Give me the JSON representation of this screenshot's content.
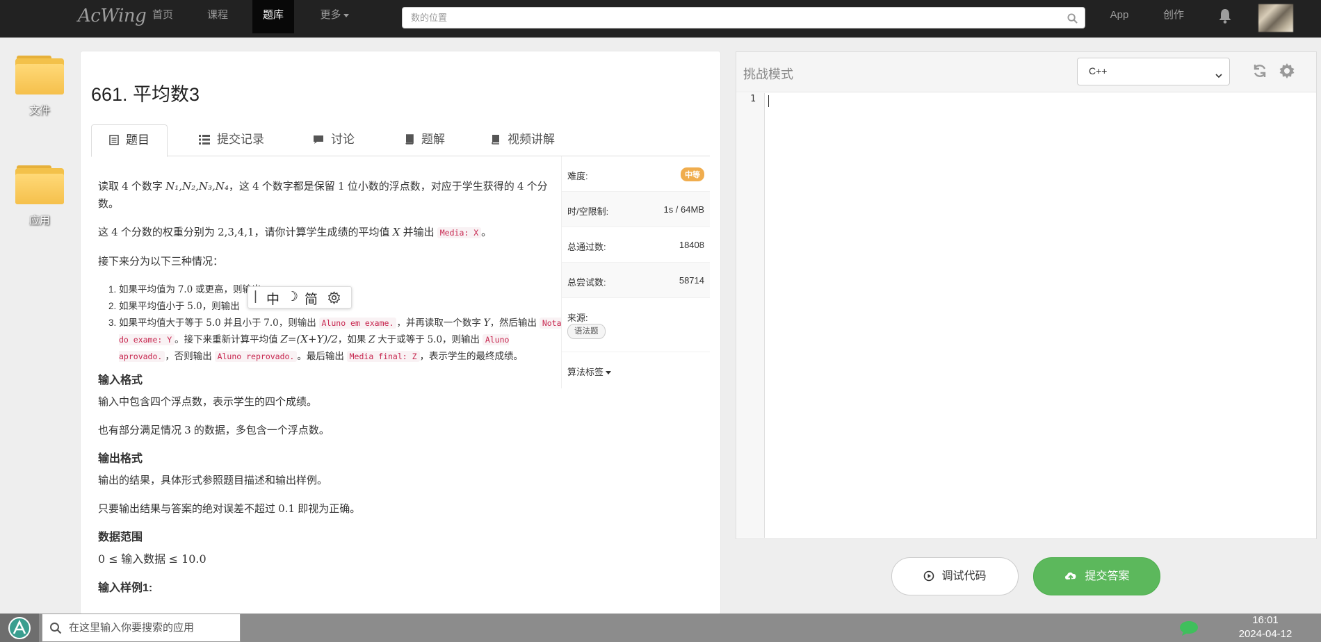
{
  "nav": {
    "logo": "AcWing",
    "links": [
      "首页",
      "课程",
      "题库",
      "更多"
    ],
    "search_placeholder": "数的位置",
    "app": "App",
    "create": "创作"
  },
  "desktop": {
    "icons": [
      "文件",
      "应用"
    ]
  },
  "problem": {
    "title": "661. 平均数3",
    "tabs": [
      "题目",
      "提交记录",
      "讨论",
      "题解",
      "视频讲解"
    ],
    "desc": {
      "p1a": "读取 ",
      "p1n": "4",
      "p1b": " 个数字 ",
      "p1vars": "N₁,N₂,N₃,N₄",
      "p1c": "，这 ",
      "p1n2": "4",
      "p1d": " 个数字都是保留 ",
      "p1n3": "1",
      "p1e": " 位小数的浮点数，对应于学生获得的 ",
      "p1n4": "4",
      "p1f": " 个分数。",
      "p2a": "这 ",
      "p2n": "4",
      "p2b": " 个分数的权重分别为 ",
      "p2w": "2,3,4,1",
      "p2c": "，请你计算学生成绩的平均值 ",
      "p2x": "X",
      "p2d": " 并输出 ",
      "p2code": "Media: X",
      "p2e": "。",
      "p3": "接下来分为以下三种情况：",
      "li1a": "如果平均值为 ",
      "li1n": "7.0",
      "li1b": " 或更高，则输出 ",
      "li1end": "。",
      "li2a": "如果平均值小于 ",
      "li2n": "5.0",
      "li2b": "，则输出",
      "li3a": "如果平均值大于等于 ",
      "li3n1": "5.0",
      "li3b": " 并且小于 ",
      "li3n2": "7.0",
      "li3c": "，则输出 ",
      "li3code1": "Aluno em exame.",
      "li3d": "，并再读取一个数字 ",
      "li3y": "Y",
      "li3e": "，然后输出 ",
      "li3code2": "Nota do exame: Y",
      "li3f": "。接下来重新计算平均值 ",
      "li3formula": "Z=(X+Y)/2",
      "li3g": "，如果 ",
      "li3z": "Z",
      "li3h": " 大于或等于 ",
      "li3n3": "5.0",
      "li3i": "，则输出 ",
      "li3code3": "Aluno aprovado.",
      "li3j": "，否则输出 ",
      "li3code4": "Aluno reprovado.",
      "li3k": "。最后输出 ",
      "li3code5": "Media final: Z",
      "li3l": "，表示学生的最终成绩。",
      "h_input": "输入格式",
      "input1": "输入中包含四个浮点数，表示学生的四个成绩。",
      "input2a": "也有部分满足情况 ",
      "input2n": "3",
      "input2b": " 的数据，多包含一个浮点数。",
      "h_output": "输出格式",
      "output1": "输出的结果，具体形式参照题目描述和输出样例。",
      "output2a": "只要输出结果与答案的绝对误差不超过 ",
      "output2n": "0.1",
      "output2b": " 即视为正确。",
      "h_range": "数据范围",
      "range_lo": "0 ≤",
      "range_mid": " 输入数据 ",
      "range_hi": "≤ 10.0",
      "h_sample": "输入样例1:"
    },
    "side": {
      "difficulty_label": "难度:",
      "difficulty": "中等",
      "limit_label": "时/空限制:",
      "limit": "1s / 64MB",
      "passed_label": "总通过数:",
      "passed": "18408",
      "tried_label": "总尝试数:",
      "tried": "58714",
      "source_label": "来源:",
      "source_tag": "语法题",
      "algo_label": "算法标签"
    }
  },
  "ime": {
    "cursor": "|",
    "mode": "中",
    "moon": "☽",
    "simp": "简"
  },
  "editor": {
    "mode": "挑战模式",
    "language": "C++",
    "line1": "1",
    "debug": "调试代码",
    "submit": "提交答案"
  },
  "taskbar": {
    "search_placeholder": "在这里输入你要搜索的应用",
    "time": "16:01",
    "date": "2024-04-12"
  },
  "colors": {
    "accent_green": "#5cb85c",
    "difficulty_orange": "#f0ad4e",
    "nav_bg": "#222222"
  }
}
